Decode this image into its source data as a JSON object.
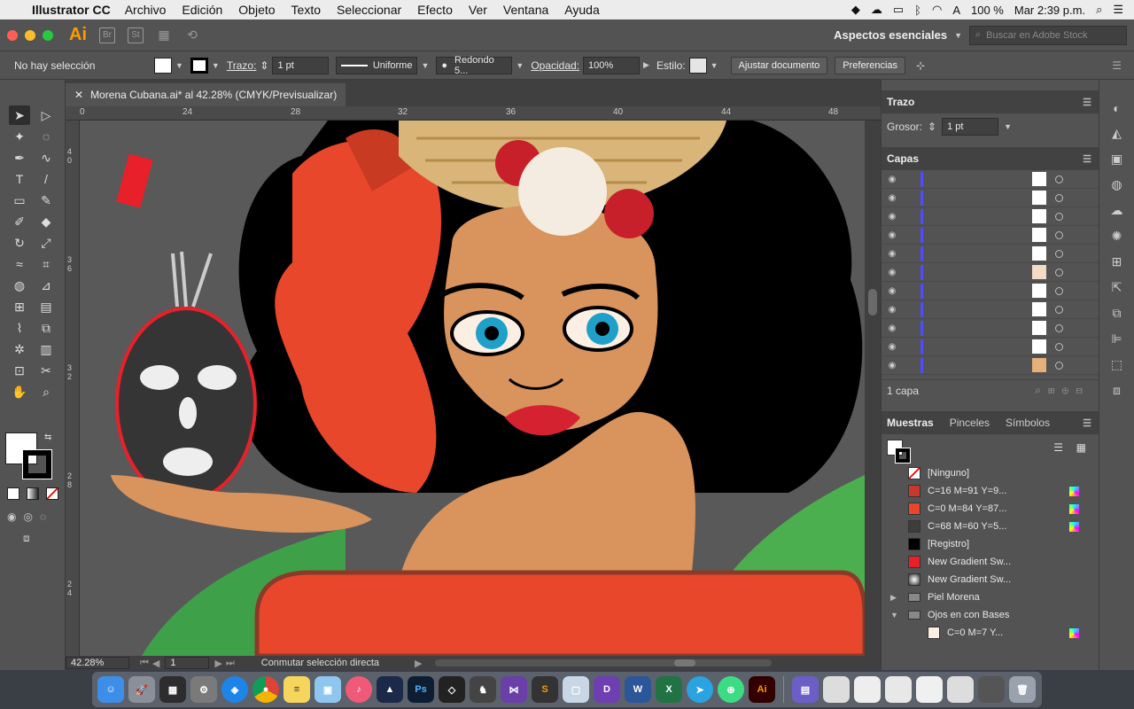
{
  "menubar": {
    "app": "Illustrator CC",
    "items": [
      "Archivo",
      "Edición",
      "Objeto",
      "Texto",
      "Seleccionar",
      "Efecto",
      "Ver",
      "Ventana",
      "Ayuda"
    ],
    "battery": "100 %",
    "clock": "Mar 2:39 p.m."
  },
  "apptop": {
    "logo": "Ai",
    "bridge": "Br",
    "stock_app": "St",
    "workspace": "Aspectos esenciales",
    "search_placeholder": "Buscar en Adobe Stock"
  },
  "control": {
    "selection": "No hay selección",
    "stroke_label": "Trazo:",
    "stroke_value": "1 pt",
    "profile": "Uniforme",
    "brush": "Redondo 5...",
    "opacity_label": "Opacidad:",
    "opacity_value": "100%",
    "style_label": "Estilo:",
    "doc_button": "Ajustar documento",
    "prefs_button": "Preferencias"
  },
  "document": {
    "tab": "Morena Cubana.ai* al 42.28% (CMYK/Previsualizar)",
    "close": "✕"
  },
  "ruler": {
    "h_ticks": [
      "0",
      "24",
      "28",
      "32",
      "36",
      "40",
      "44",
      "48"
    ],
    "v_ticks": [
      "4 0",
      "3 6",
      "3 2",
      "2 8",
      "2 4"
    ]
  },
  "status": {
    "zoom": "42.28%",
    "artboard": "1",
    "tool_hint": "Conmutar selección directa"
  },
  "panels": {
    "stroke": {
      "title": "Trazo",
      "weight_label": "Grosor:",
      "weight_value": "1 pt"
    },
    "layers": {
      "title": "Capas",
      "count": "1 capa"
    },
    "swatches": {
      "tabs": [
        "Muestras",
        "Pinceles",
        "Símbolos"
      ],
      "items": [
        {
          "name": "[Ninguno]",
          "color": "none"
        },
        {
          "name": "C=16 M=91 Y=9...",
          "color": "#c8392b"
        },
        {
          "name": "C=0 M=84 Y=87...",
          "color": "#e8472b"
        },
        {
          "name": "C=68 M=60 Y=5...",
          "color": "#3d3d3d"
        },
        {
          "name": "[Registro]",
          "color": "#000000"
        },
        {
          "name": "New Gradient Sw...",
          "color": "#e8202a"
        },
        {
          "name": "New Gradient Sw...",
          "color": "#777777"
        },
        {
          "name": "Piel Morena",
          "color": "folder"
        },
        {
          "name": "Ojos en con Bases",
          "color": "folder"
        },
        {
          "name": "C=0 M=7 Y...",
          "color": "#fbeee2"
        }
      ]
    }
  },
  "colors": {
    "menubar": "#ececec",
    "chrome": "#535353",
    "canvas": "#595959",
    "accent_red": "#e8472b",
    "skin": "#d9935c",
    "hair": "#000000",
    "eye": "#1ea0c8"
  },
  "dock": {
    "items": [
      "finder-icon",
      "launchpad-icon",
      "photo-icon",
      "sysprefs-icon",
      "safari-icon",
      "chrome-icon",
      "notes-icon",
      "preview-icon",
      "itunes-icon",
      "affinity-icon",
      "photoshop-icon",
      "unity-icon",
      "tableplus-icon",
      "vs-icon",
      "sublime-icon",
      "box-icon",
      "dash-icon",
      "word-icon",
      "excel-icon",
      "telegram-icon",
      "android-icon",
      "illustrator-icon"
    ]
  }
}
